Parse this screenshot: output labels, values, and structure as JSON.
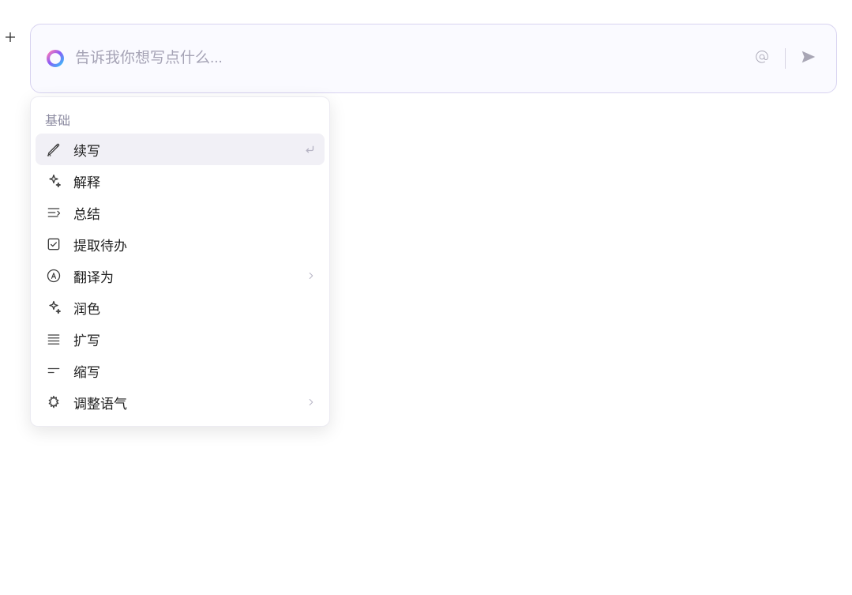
{
  "input": {
    "placeholder": "告诉我你想写点什么..."
  },
  "menu": {
    "section_label": "基础",
    "items": [
      {
        "label": "续写",
        "icon": "pencil-icon",
        "selected": true,
        "trail": "enter"
      },
      {
        "label": "解释",
        "icon": "sparkle-icon",
        "selected": false,
        "trail": null
      },
      {
        "label": "总结",
        "icon": "summary-icon",
        "selected": false,
        "trail": null
      },
      {
        "label": "提取待办",
        "icon": "checkbox-icon",
        "selected": false,
        "trail": null
      },
      {
        "label": "翻译为",
        "icon": "translate-icon",
        "selected": false,
        "trail": "chevron"
      },
      {
        "label": "润色",
        "icon": "sparkle-icon",
        "selected": false,
        "trail": null
      },
      {
        "label": "扩写",
        "icon": "expand-icon",
        "selected": false,
        "trail": null
      },
      {
        "label": "缩写",
        "icon": "shrink-icon",
        "selected": false,
        "trail": null
      },
      {
        "label": "调整语气",
        "icon": "tone-icon",
        "selected": false,
        "trail": "chevron"
      }
    ]
  }
}
